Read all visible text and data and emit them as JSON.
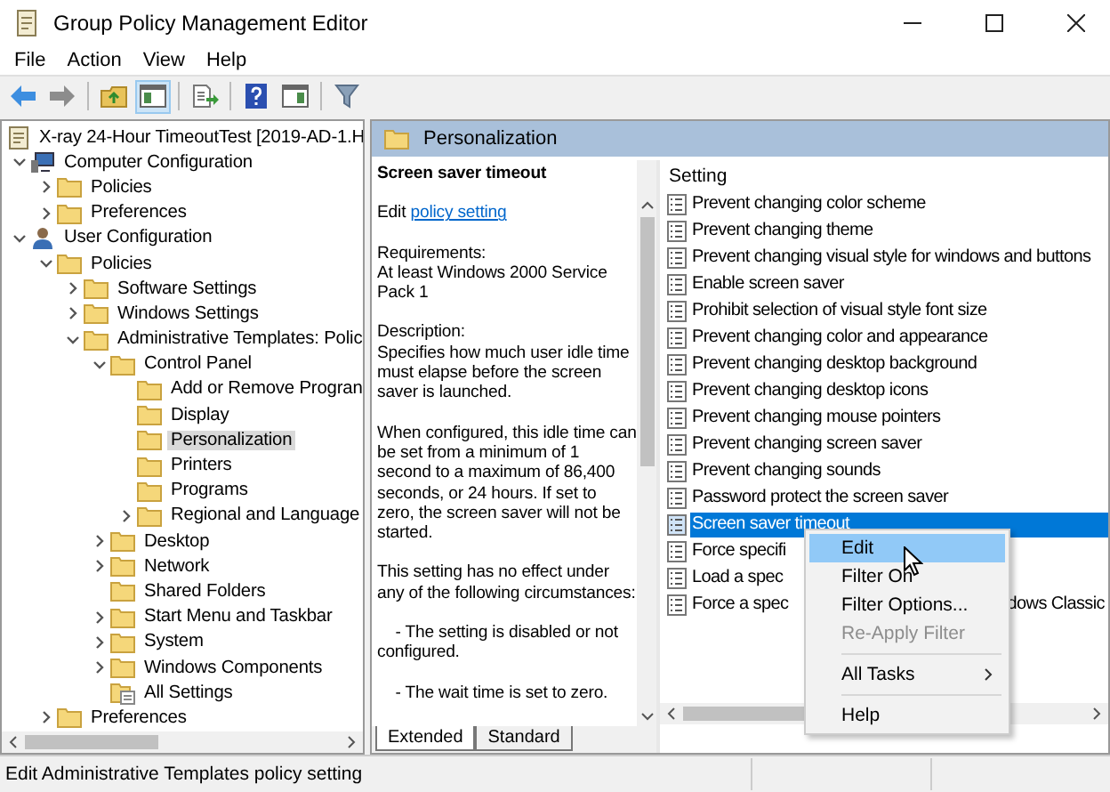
{
  "window": {
    "title": "Group Policy Management Editor"
  },
  "menu": [
    "File",
    "Action",
    "View",
    "Help"
  ],
  "toolbar": [
    {
      "kind": "back",
      "disabled": false,
      "pressed": false
    },
    {
      "kind": "forward",
      "disabled": true,
      "pressed": false
    },
    {
      "kind": "separator"
    },
    {
      "kind": "up",
      "pressed": false
    },
    {
      "kind": "tree",
      "pressed": true
    },
    {
      "kind": "separator"
    },
    {
      "kind": "export",
      "pressed": false
    },
    {
      "kind": "separator"
    },
    {
      "kind": "help",
      "pressed": false
    },
    {
      "kind": "pane",
      "pressed": false
    },
    {
      "kind": "separator"
    },
    {
      "kind": "filter",
      "pressed": false
    }
  ],
  "tree": {
    "root": "X-ray 24-Hour TimeoutTest [2019-AD-1.H",
    "items": [
      {
        "label": "Computer Configuration",
        "kind": "computer",
        "expanded": true,
        "selected": false,
        "children": [
          {
            "label": "Policies",
            "kind": "folder",
            "expanded": false,
            "selected": false
          },
          {
            "label": "Preferences",
            "kind": "folder",
            "expanded": false,
            "selected": false
          }
        ]
      },
      {
        "label": "User Configuration",
        "kind": "user",
        "expanded": true,
        "selected": false,
        "children": [
          {
            "label": "Policies",
            "kind": "folder",
            "expanded": true,
            "selected": false,
            "children": [
              {
                "label": "Software Settings",
                "kind": "folder",
                "expanded": false,
                "selected": false
              },
              {
                "label": "Windows Settings",
                "kind": "folder",
                "expanded": false,
                "selected": false
              },
              {
                "label": "Administrative Templates: Polic",
                "kind": "folder",
                "expanded": true,
                "selected": false,
                "children": [
                  {
                    "label": "Control Panel",
                    "kind": "folder",
                    "expanded": true,
                    "selected": false,
                    "children": [
                      {
                        "label": "Add or Remove Progran",
                        "kind": "folder",
                        "selected": false
                      },
                      {
                        "label": "Display",
                        "kind": "folder",
                        "selected": false
                      },
                      {
                        "label": "Personalization",
                        "kind": "folder",
                        "selected": true
                      },
                      {
                        "label": "Printers",
                        "kind": "folder",
                        "selected": false
                      },
                      {
                        "label": "Programs",
                        "kind": "folder",
                        "selected": false
                      },
                      {
                        "label": "Regional and Language",
                        "kind": "folder",
                        "expanded": false,
                        "selected": false
                      }
                    ]
                  },
                  {
                    "label": "Desktop",
                    "kind": "folder",
                    "expanded": false,
                    "selected": false
                  },
                  {
                    "label": "Network",
                    "kind": "folder",
                    "expanded": false,
                    "selected": false
                  },
                  {
                    "label": "Shared Folders",
                    "kind": "folder",
                    "selected": false
                  },
                  {
                    "label": "Start Menu and Taskbar",
                    "kind": "folder",
                    "expanded": false,
                    "selected": false
                  },
                  {
                    "label": "System",
                    "kind": "folder",
                    "expanded": false,
                    "selected": false
                  },
                  {
                    "label": "Windows Components",
                    "kind": "folder",
                    "expanded": false,
                    "selected": false
                  },
                  {
                    "label": "All Settings",
                    "kind": "settings",
                    "selected": false
                  }
                ]
              }
            ]
          },
          {
            "label": "Preferences",
            "kind": "folder",
            "expanded": false,
            "selected": false
          }
        ]
      }
    ]
  },
  "header": {
    "title": "Personalization"
  },
  "description": {
    "title": "Screen saver timeout",
    "edit_prefix": "Edit",
    "edit_link": "policy setting",
    "paragraphs": [
      "Requirements:\nAt least Windows 2000 Service Pack 1",
      "Description:\nSpecifies how much user idle time must elapse before the screen saver is launched.",
      "When configured, this idle time can be set from a minimum of 1 second to a maximum of 86,400 seconds, or 24 hours. If set to zero, the screen saver will not be started.",
      "This setting has no effect under any of the following circumstances:",
      "    - The setting is disabled or not configured.",
      "    - The wait time is set to zero."
    ]
  },
  "settings": {
    "column": "Setting",
    "rows": [
      {
        "label": "Prevent changing color scheme",
        "selected": false
      },
      {
        "label": "Prevent changing theme",
        "selected": false
      },
      {
        "label": "Prevent changing visual style for windows and buttons",
        "selected": false
      },
      {
        "label": "Enable screen saver",
        "selected": false
      },
      {
        "label": "Prohibit selection of visual style font size",
        "selected": false
      },
      {
        "label": "Prevent changing color and appearance",
        "selected": false
      },
      {
        "label": "Prevent changing desktop background",
        "selected": false
      },
      {
        "label": "Prevent changing desktop icons",
        "selected": false
      },
      {
        "label": "Prevent changing mouse pointers",
        "selected": false
      },
      {
        "label": "Prevent changing screen saver",
        "selected": false
      },
      {
        "label": "Prevent changing sounds",
        "selected": false
      },
      {
        "label": "Password protect the screen saver",
        "selected": false
      },
      {
        "label": "Screen saver timeout",
        "selected": true
      },
      {
        "label": "Force specifi",
        "selected": false
      },
      {
        "label": "Load a spec",
        "selected": false
      },
      {
        "label": "Force a spec",
        "tail": "dows Classic",
        "selected": false
      }
    ]
  },
  "tabs": [
    {
      "label": "Extended",
      "selected": true
    },
    {
      "label": "Standard",
      "selected": false
    }
  ],
  "context_menu": [
    {
      "kind": "item",
      "label": "Edit",
      "selected": true,
      "disabled": false,
      "submenu": false
    },
    {
      "kind": "item",
      "label": "Filter On",
      "selected": false,
      "disabled": false,
      "submenu": false
    },
    {
      "kind": "item",
      "label": "Filter Options...",
      "selected": false,
      "disabled": false,
      "submenu": false
    },
    {
      "kind": "item",
      "label": "Re-Apply Filter",
      "selected": false,
      "disabled": true,
      "submenu": false
    },
    {
      "kind": "separator"
    },
    {
      "kind": "item",
      "label": "All Tasks",
      "selected": false,
      "disabled": false,
      "submenu": true
    },
    {
      "kind": "separator"
    },
    {
      "kind": "item",
      "label": "Help",
      "selected": false,
      "disabled": false,
      "submenu": false
    }
  ],
  "status_bar": {
    "text": "Edit Administrative Templates policy setting"
  }
}
